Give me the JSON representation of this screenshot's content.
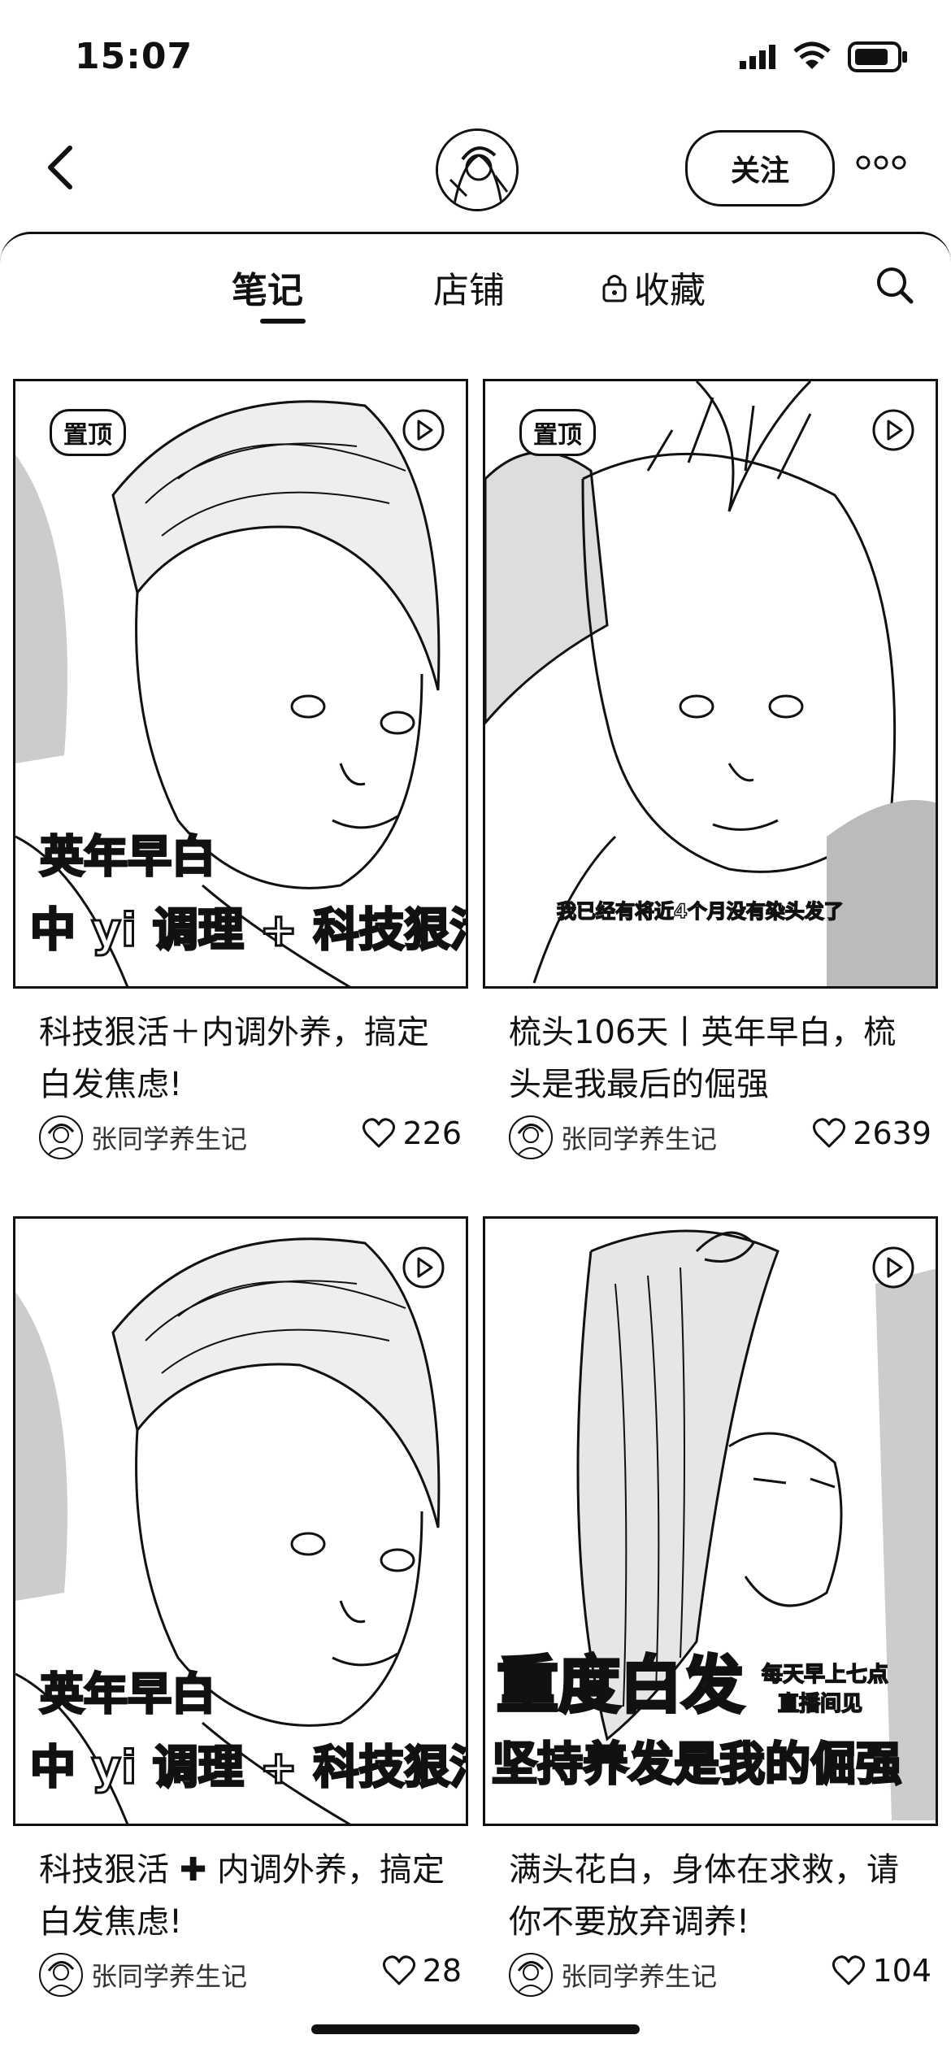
{
  "status_bar": {
    "time": "15:07"
  },
  "header": {
    "follow_label": "关注"
  },
  "tabs": [
    {
      "label": "笔记"
    },
    {
      "label": "店铺"
    },
    {
      "label": "收藏"
    }
  ],
  "notes": [
    {
      "pinned_label": "置顶",
      "caption_lines": [
        "英年早白",
        "中 yi 调理 + 科技狠活"
      ],
      "title": "科技狠活＋内调外养，搞定白发焦虑!",
      "author": "张同学养生记",
      "likes": "226"
    },
    {
      "pinned_label": "置顶",
      "caption_lines": [
        "我已经有将近4个月没有染头发了"
      ],
      "title": "梳头106天丨英年早白，梳头是我最后的倔强",
      "author": "张同学养生记",
      "likes": "2639"
    },
    {
      "caption_lines": [
        "英年早白",
        "中 yi 调理 + 科技狠活"
      ],
      "title": "科技狠活 ✚ 内调外养，搞定白发焦虑!",
      "author": "张同学养生记",
      "likes": "28"
    },
    {
      "caption_lines": [
        "重度白发",
        "每天早上七点",
        "直播间见",
        "坚持养发是我的倔强"
      ],
      "title": "满头花白，身体在求救，请你不要放弃调养!",
      "author": "张同学养生记",
      "likes": "104"
    }
  ]
}
